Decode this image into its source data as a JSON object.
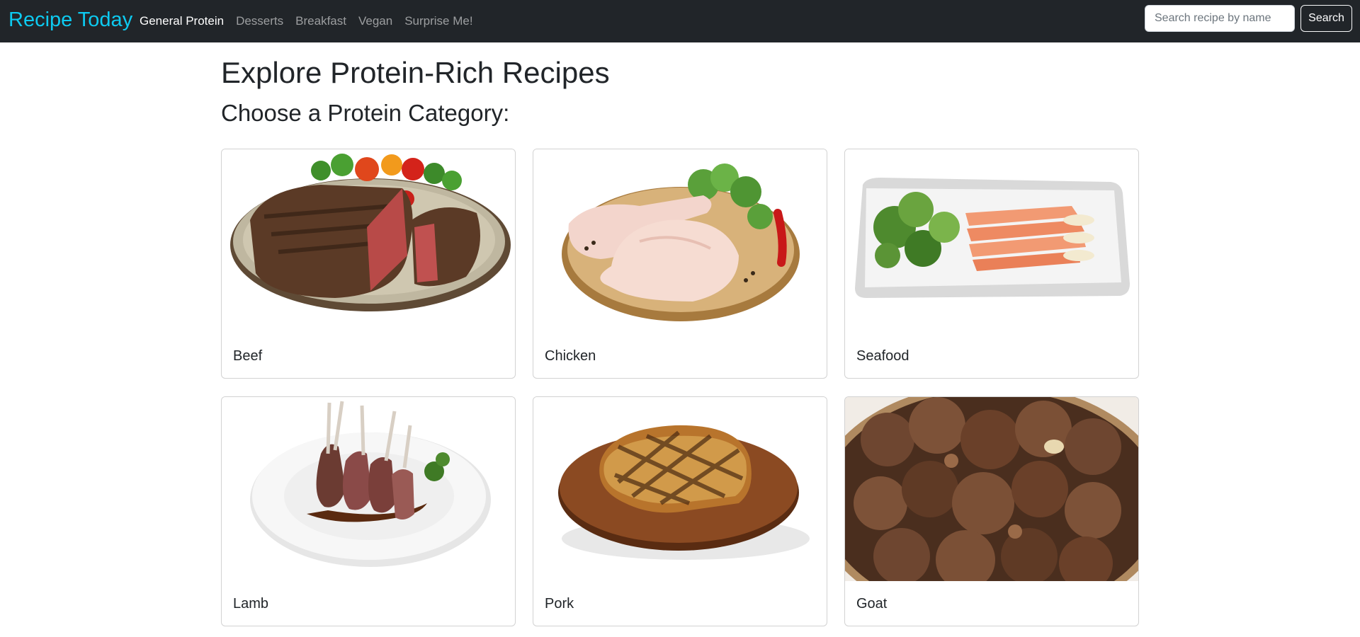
{
  "navbar": {
    "brand": "Recipe Today",
    "links": [
      {
        "label": "General Protein",
        "active": true
      },
      {
        "label": "Desserts",
        "active": false
      },
      {
        "label": "Breakfast",
        "active": false
      },
      {
        "label": "Vegan",
        "active": false
      },
      {
        "label": "Surprise Me!",
        "active": false
      }
    ],
    "search": {
      "placeholder": "Search recipe by name",
      "value": "",
      "button_label": "Search"
    }
  },
  "main": {
    "title": "Explore Protein-Rich Recipes",
    "subtitle": "Choose a Protein Category:",
    "categories": [
      {
        "label": "Beef",
        "image": "grilled-steak-plate"
      },
      {
        "label": "Chicken",
        "image": "raw-chicken-legs-board"
      },
      {
        "label": "Seafood",
        "image": "salmon-salad-plate"
      },
      {
        "label": "Lamb",
        "image": "lamb-chops-plate"
      },
      {
        "label": "Pork",
        "image": "pork-chop-board"
      },
      {
        "label": "Goat",
        "image": "goat-stew-bowl"
      }
    ]
  },
  "colors": {
    "navbar_bg": "#212529",
    "brand": "#0dcaf0",
    "text": "#212529",
    "card_border": "#dee2e6"
  }
}
